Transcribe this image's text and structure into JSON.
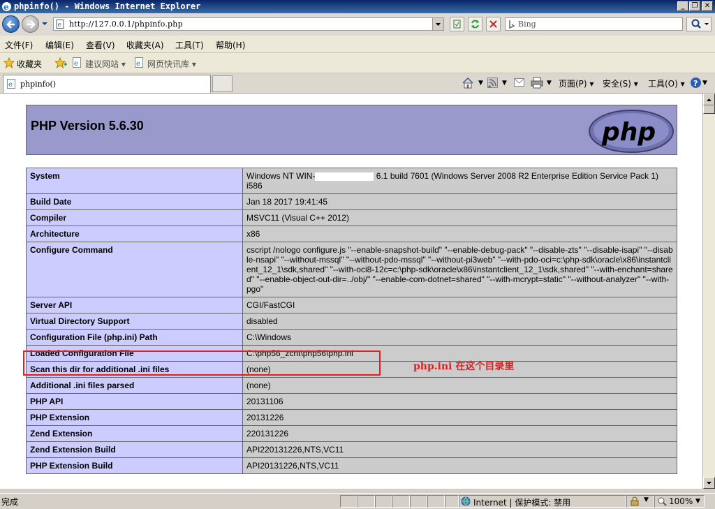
{
  "window": {
    "title": "phpinfo() - Windows Internet Explorer"
  },
  "address": {
    "url": "http://127.0.0.1/phpinfo.php",
    "search_placeholder": "Bing"
  },
  "menu": [
    "文件(F)",
    "编辑(E)",
    "查看(V)",
    "收藏夹(A)",
    "工具(T)",
    "帮助(H)"
  ],
  "favorites": {
    "label": "收藏夹",
    "items": [
      "建议网站 ▾",
      "网页快讯库 ▾"
    ]
  },
  "tab": {
    "label": "phpinfo()"
  },
  "commands": {
    "page": "页面(P) ▾",
    "safety": "安全(S) ▾",
    "tools": "工具(O) ▾"
  },
  "php": {
    "version": "PHP Version 5.6.30",
    "rows": [
      {
        "k": "System",
        "v1": "Windows NT WIN-",
        "v2": "6.1 build 7601 (Windows Server 2008 R2 Enterprise Edition Service Pack 1) i586"
      },
      {
        "k": "Build Date",
        "v": "Jan 18 2017 19:41:45"
      },
      {
        "k": "Compiler",
        "v": "MSVC11 (Visual C++ 2012)"
      },
      {
        "k": "Architecture",
        "v": "x86"
      },
      {
        "k": "Configure Command",
        "v": "cscript /nologo configure.js \"--enable-snapshot-build\" \"--enable-debug-pack\" \"--disable-zts\" \"--disable-isapi\" \"--disable-nsapi\" \"--without-mssql\" \"--without-pdo-mssql\" \"--without-pi3web\" \"--with-pdo-oci=c:\\php-sdk\\oracle\\x86\\instantclient_12_1\\sdk,shared\" \"--with-oci8-12c=c:\\php-sdk\\oracle\\x86\\instantclient_12_1\\sdk,shared\" \"--with-enchant=shared\" \"--enable-object-out-dir=../obj/\" \"--enable-com-dotnet=shared\" \"--with-mcrypt=static\" \"--without-analyzer\" \"--with-pgo\""
      },
      {
        "k": "Server API",
        "v": "CGI/FastCGI"
      },
      {
        "k": "Virtual Directory Support",
        "v": "disabled"
      },
      {
        "k": "Configuration File (php.ini) Path",
        "v": "C:\\Windows"
      },
      {
        "k": "Loaded Configuration File",
        "v": "C:\\php56_zcnt\\php56\\php.ini"
      },
      {
        "k": "Scan this dir for additional .ini files",
        "v": "(none)"
      },
      {
        "k": "Additional .ini files parsed",
        "v": "(none)"
      },
      {
        "k": "PHP API",
        "v": "20131106"
      },
      {
        "k": "PHP Extension",
        "v": "20131226"
      },
      {
        "k": "Zend Extension",
        "v": "220131226"
      },
      {
        "k": "Zend Extension Build",
        "v": "API220131226,NTS,VC11"
      },
      {
        "k": "PHP Extension Build",
        "v": "API20131226,NTS,VC11"
      }
    ]
  },
  "annotation": "php.ini  在这个目录里",
  "status": {
    "text": "完成",
    "zone": "Internet | 保护模式: 禁用",
    "zoom": "100%"
  }
}
